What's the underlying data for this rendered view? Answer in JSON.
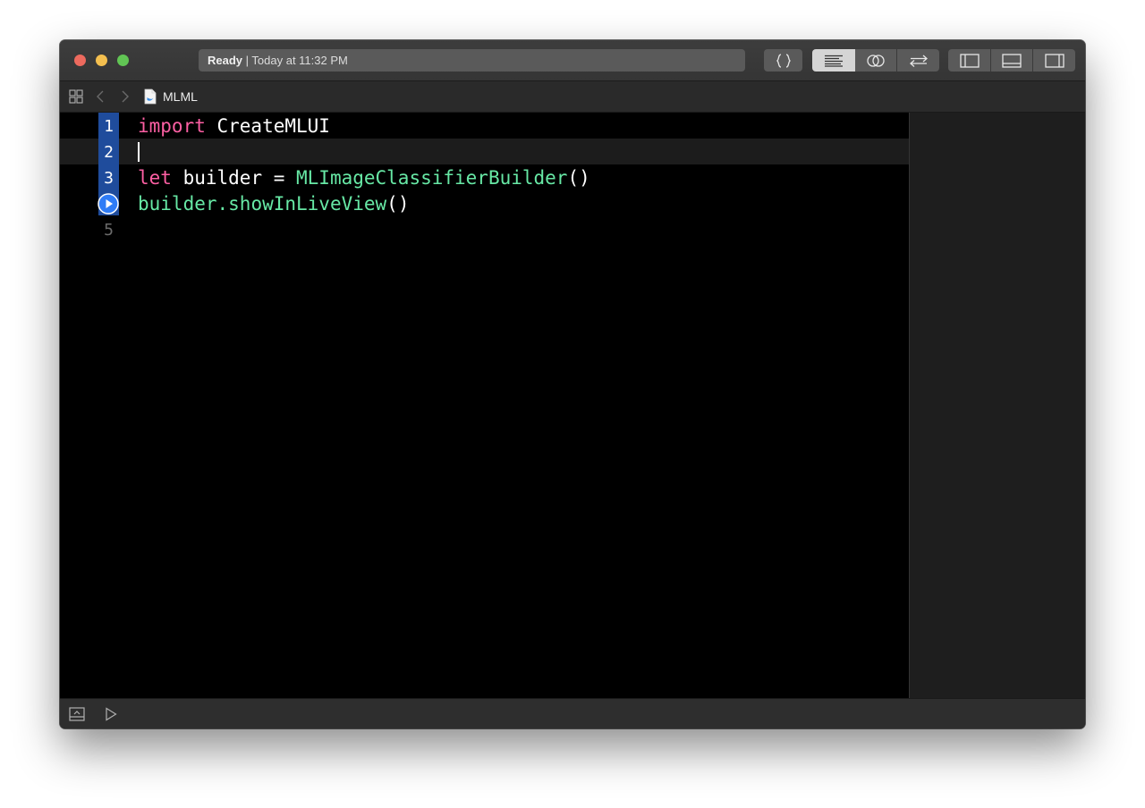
{
  "toolbar": {
    "status_ready": "Ready",
    "status_separator": " | ",
    "status_time": "Today at 11:32 PM",
    "buttons": [
      "braces-icon",
      "standard-editor-icon",
      "assistant-editor-icon",
      "version-editor-icon",
      "navigator-toggle-icon",
      "debug-area-toggle-icon",
      "utilities-toggle-icon"
    ]
  },
  "jumpbar": {
    "file_name": "MLML",
    "icons": [
      "grid-icon",
      "back-arrow-icon",
      "forward-arrow-icon",
      "swift-file-icon"
    ]
  },
  "editor": {
    "line_numbers": [
      "1",
      "2",
      "3",
      "",
      "5"
    ],
    "lines": [
      {
        "tokens": [
          {
            "text": "import",
            "kind": "keyword"
          },
          {
            "text": " CreateMLUI",
            "kind": "plain"
          }
        ]
      },
      {
        "tokens": []
      },
      {
        "tokens": [
          {
            "text": "let",
            "kind": "keyword"
          },
          {
            "text": " builder = ",
            "kind": "plain"
          },
          {
            "text": "MLImageClassifierBuilder",
            "kind": "type"
          },
          {
            "text": "()",
            "kind": "plain"
          }
        ]
      },
      {
        "tokens": [
          {
            "text": "builder.",
            "kind": "type"
          },
          {
            "text": "showInLiveView",
            "kind": "type"
          },
          {
            "text": "()",
            "kind": "plain"
          }
        ]
      },
      {
        "tokens": []
      }
    ],
    "run_marker_line": 4
  },
  "colors": {
    "keyword": "#fc5fa3",
    "type": "#67e8a5",
    "plain": "#ffffff",
    "gutter_highlight": "#1f4c9c"
  },
  "bottombar": {
    "icons": [
      "show-debug-area-icon",
      "run-playground-icon"
    ]
  }
}
